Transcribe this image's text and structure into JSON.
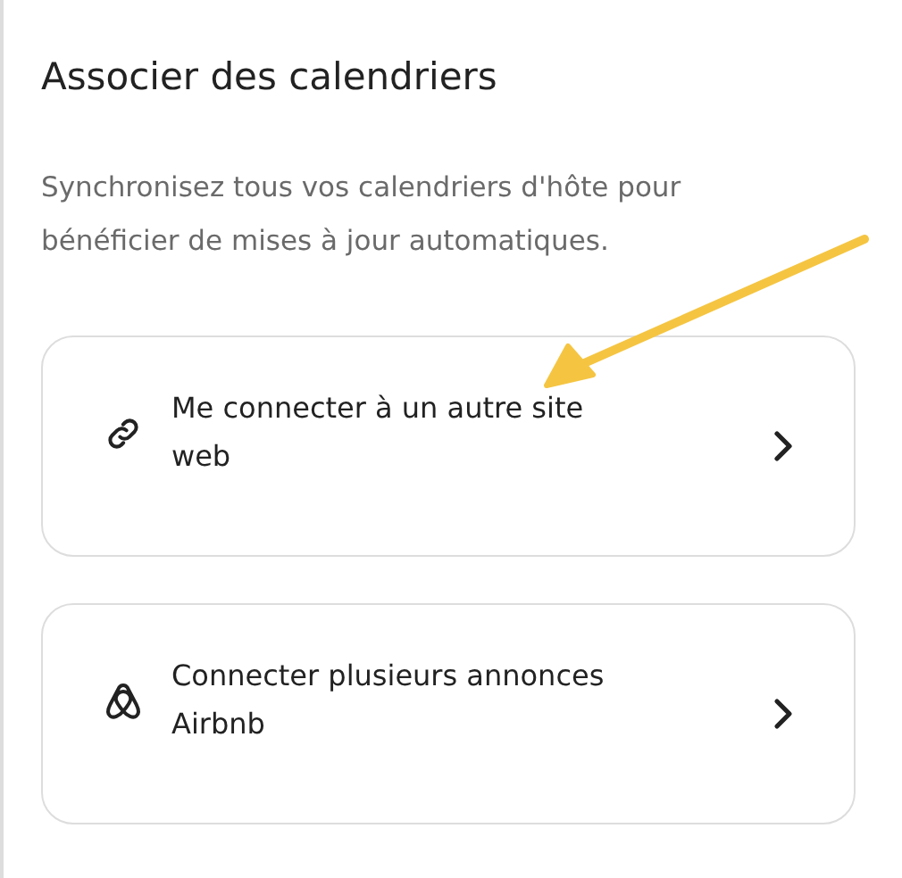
{
  "title": "Associer des calendriers",
  "description": "Synchronisez tous vos calendriers d'hôte pour\nbénéficier de mises à jour automatiques.",
  "options": [
    {
      "kind": "link",
      "label": "Me connecter à un autre site\nweb"
    },
    {
      "kind": "logo",
      "label": "Connecter plusieurs annonces\nAirbnb"
    }
  ]
}
